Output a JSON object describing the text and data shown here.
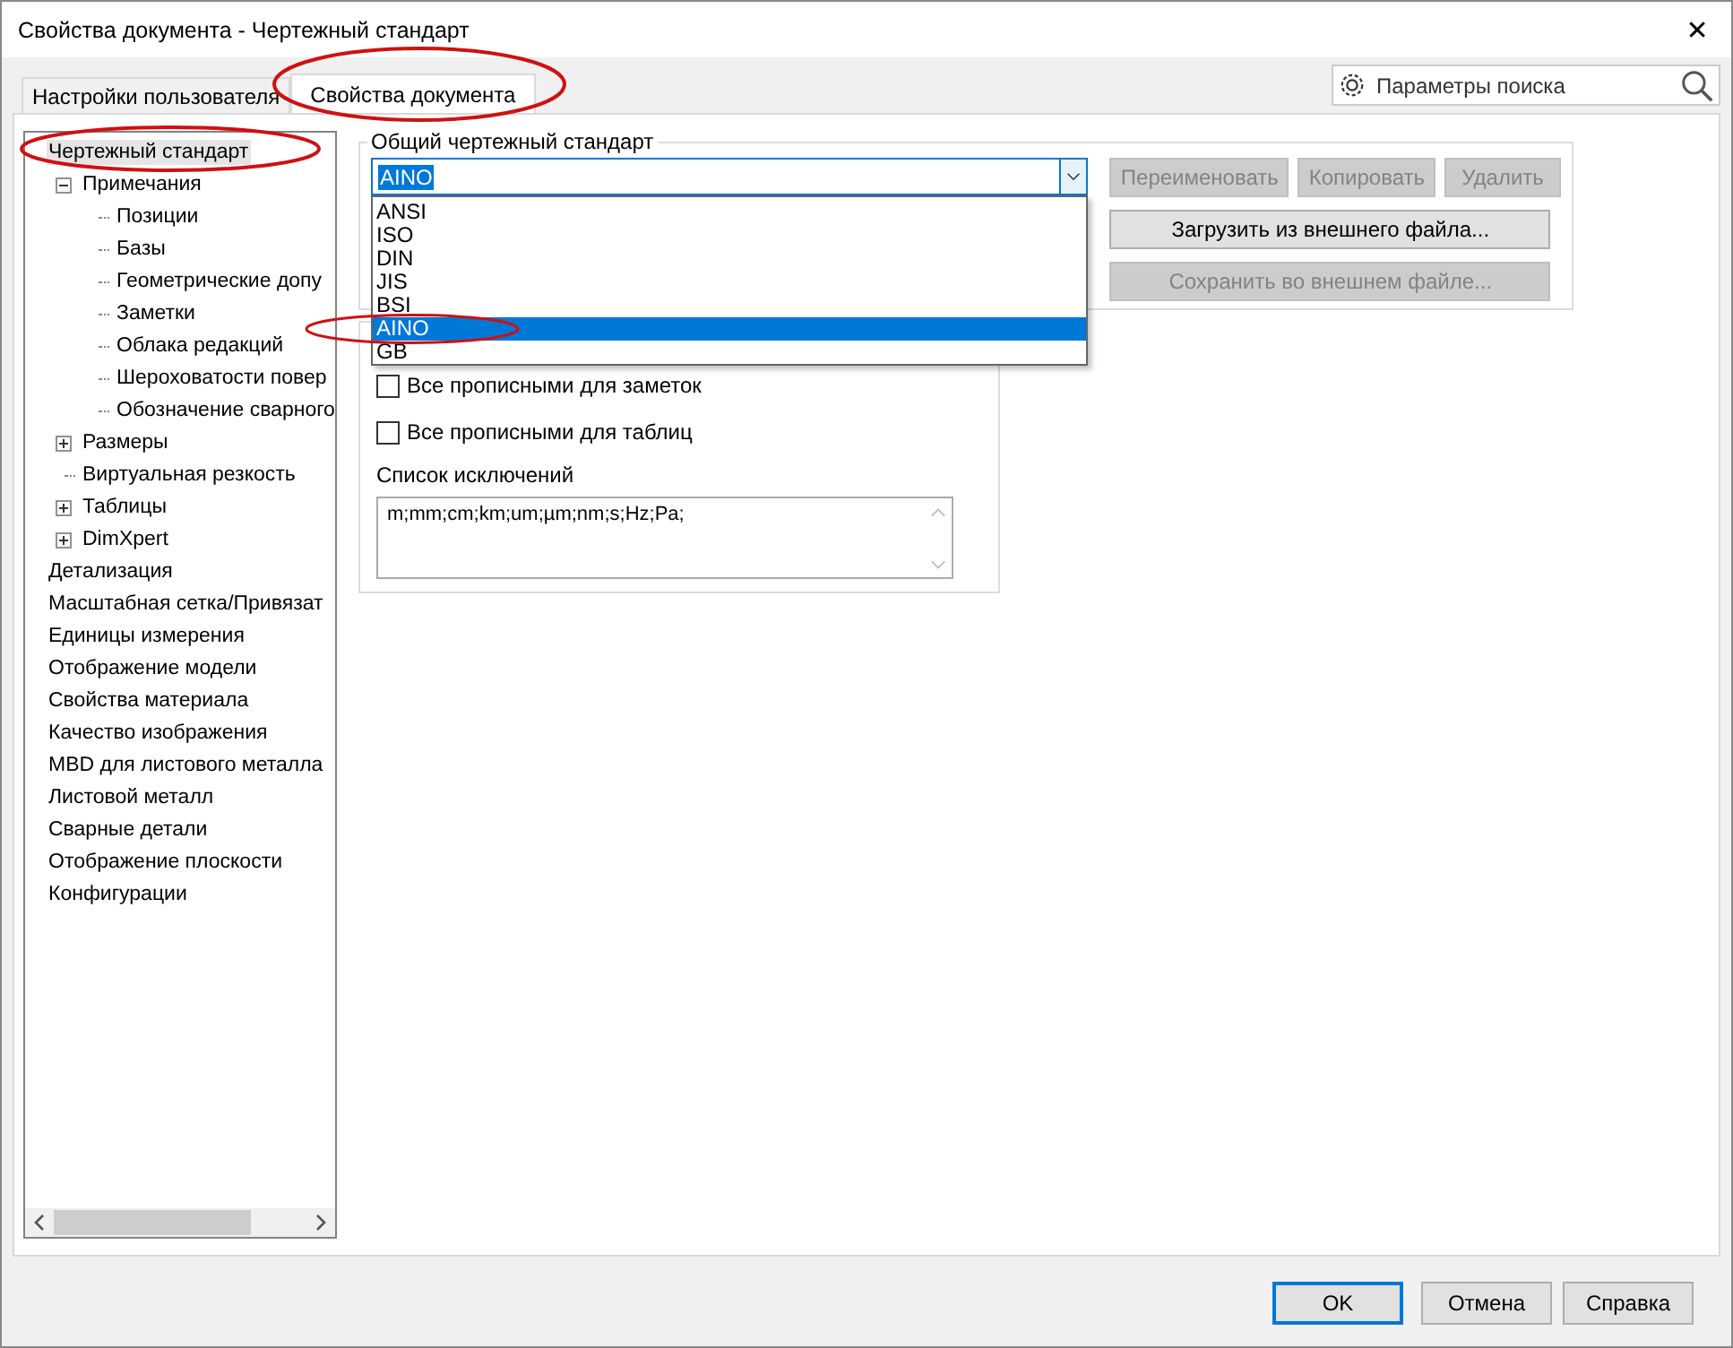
{
  "window": {
    "title": "Свойства документа - Чертежный стандарт",
    "close": "✕"
  },
  "tabs": [
    {
      "label": "Настройки пользователя",
      "selected": false
    },
    {
      "label": "Свойства документа",
      "selected": true
    }
  ],
  "search": {
    "placeholder": "Параметры поиска"
  },
  "tree": [
    {
      "label": "Чертежный стандарт",
      "selected": true,
      "children": [
        {
          "label": "Примечания",
          "selected": false,
          "expanded": true,
          "children": [
            {
              "label": "Позиции",
              "selected": false
            },
            {
              "label": "Базы",
              "selected": false
            },
            {
              "label": "Геометрические допу",
              "selected": false
            },
            {
              "label": "Заметки",
              "selected": false
            },
            {
              "label": "Облака редакций",
              "selected": false
            },
            {
              "label": "Шероховатости повер",
              "selected": false
            },
            {
              "label": "Обозначение сварного",
              "selected": false
            }
          ]
        },
        {
          "label": "Размеры",
          "selected": false,
          "expanded": false
        },
        {
          "label": "Виртуальная резкость",
          "selected": false
        },
        {
          "label": "Таблицы",
          "selected": false,
          "expanded": false
        },
        {
          "label": "DimXpert",
          "selected": false,
          "expanded": false
        }
      ]
    },
    {
      "label": "Детализация",
      "selected": false
    },
    {
      "label": "Масштабная сетка/Привязат",
      "selected": false
    },
    {
      "label": "Единицы измерения",
      "selected": false
    },
    {
      "label": "Отображение модели",
      "selected": false
    },
    {
      "label": "Свойства материала",
      "selected": false
    },
    {
      "label": "Качество изображения",
      "selected": false
    },
    {
      "label": "MBD для листового металла",
      "selected": false
    },
    {
      "label": "Листовой металл",
      "selected": false
    },
    {
      "label": "Сварные детали",
      "selected": false
    },
    {
      "label": "Отображение плоскости",
      "selected": false
    },
    {
      "label": "Конфигурации",
      "selected": false
    }
  ],
  "standard": {
    "group_label": "Общий чертежный стандарт",
    "value": "AINO",
    "options": [
      {
        "label": "ANSI",
        "selected": false
      },
      {
        "label": "ISO",
        "selected": false
      },
      {
        "label": "DIN",
        "selected": false
      },
      {
        "label": "JIS",
        "selected": false
      },
      {
        "label": "BSI",
        "selected": false
      },
      {
        "label": "AINO",
        "selected": true
      },
      {
        "label": "GB",
        "selected": false
      }
    ],
    "buttons": [
      {
        "label": "Переименовать",
        "disabled": true
      },
      {
        "label": "Копировать",
        "disabled": true
      },
      {
        "label": "Удалить",
        "disabled": true
      }
    ],
    "load_button": {
      "label": "Загрузить из внешнего файла...",
      "disabled": false
    },
    "save_button": {
      "label": "Сохранить во внешнем файле...",
      "disabled": true
    }
  },
  "options": {
    "checkboxes": [
      {
        "label": "Все прописными для заметок",
        "checked": false
      },
      {
        "label": "Все прописными для таблиц",
        "checked": false
      }
    ],
    "exceptions_label": "Список исключений",
    "exceptions_value": "m;mm;cm;km;um;µm;nm;s;Hz;Pa;"
  },
  "footer_buttons": [
    {
      "label": "OK",
      "default": true
    },
    {
      "label": "Отмена",
      "default": false
    },
    {
      "label": "Справка",
      "default": false
    }
  ]
}
